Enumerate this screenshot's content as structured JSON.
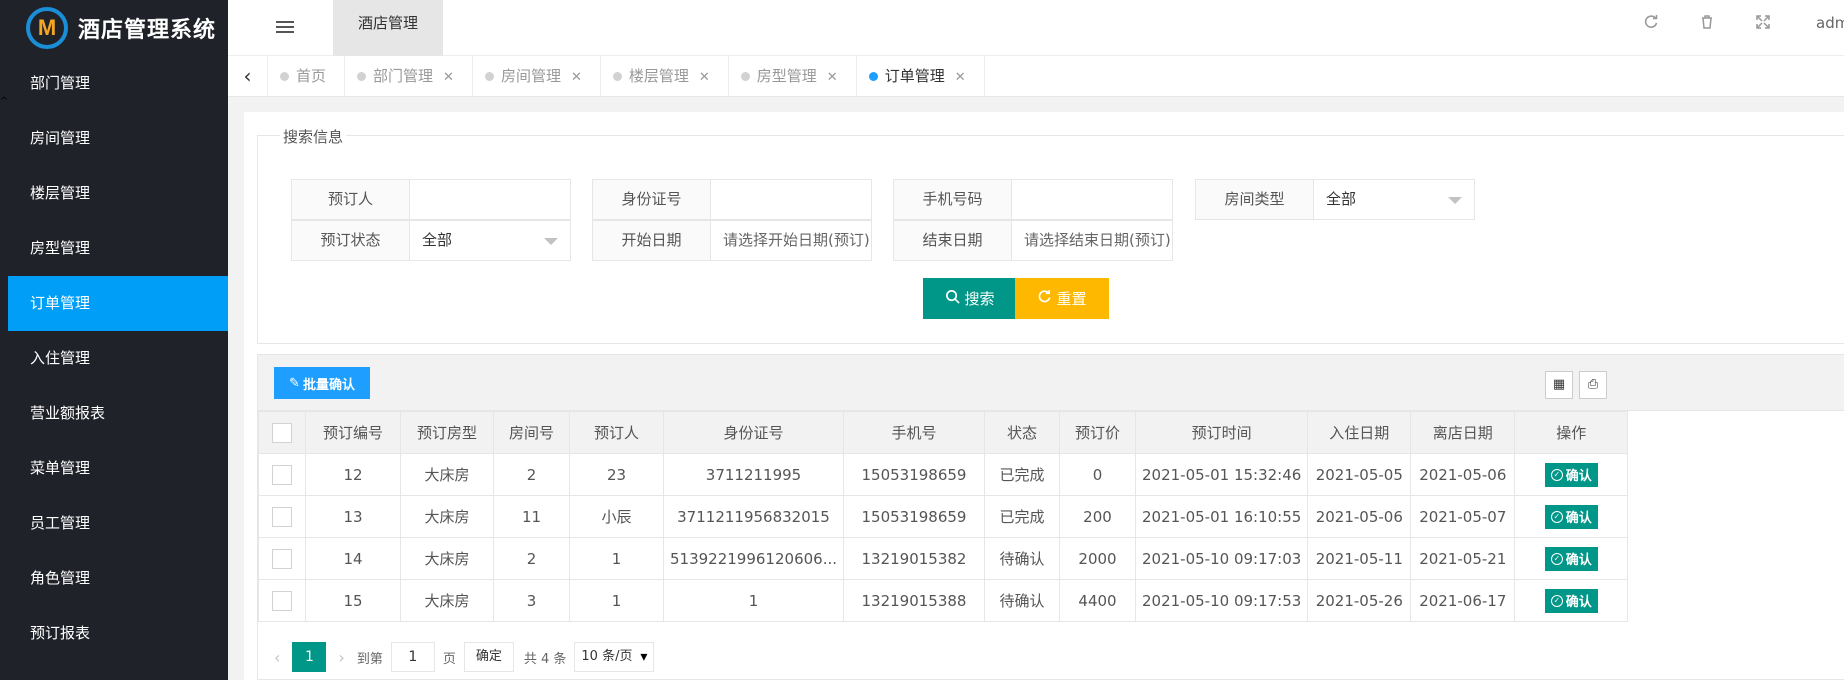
{
  "app": {
    "title": "酒店管理系统",
    "logo_letter": "M"
  },
  "sidebar": {
    "items": [
      {
        "label": "部门管理",
        "active": false
      },
      {
        "label": "房间管理",
        "active": false
      },
      {
        "label": "楼层管理",
        "active": false
      },
      {
        "label": "房型管理",
        "active": false
      },
      {
        "label": "订单管理",
        "active": true
      },
      {
        "label": "入住管理",
        "active": false
      },
      {
        "label": "营业额报表",
        "active": false
      },
      {
        "label": "菜单管理",
        "active": false
      },
      {
        "label": "员工管理",
        "active": false
      },
      {
        "label": "角色管理",
        "active": false
      },
      {
        "label": "预订报表",
        "active": false
      }
    ]
  },
  "header": {
    "tab_label": "酒店管理",
    "user": "adm",
    "icons": [
      "refresh-icon",
      "trash-icon",
      "fullscreen-icon"
    ]
  },
  "tabs": [
    {
      "label": "首页",
      "active": false,
      "closable": false
    },
    {
      "label": "部门管理",
      "active": false,
      "closable": true
    },
    {
      "label": "房间管理",
      "active": false,
      "closable": true
    },
    {
      "label": "楼层管理",
      "active": false,
      "closable": true
    },
    {
      "label": "房型管理",
      "active": false,
      "closable": true
    },
    {
      "label": "订单管理",
      "active": true,
      "closable": true
    }
  ],
  "search": {
    "legend": "搜索信息",
    "fields": {
      "booker": {
        "label": "预订人",
        "value": ""
      },
      "id_card": {
        "label": "身份证号",
        "value": ""
      },
      "phone": {
        "label": "手机号码",
        "value": ""
      },
      "room_type": {
        "label": "房间类型",
        "value": "全部"
      },
      "status": {
        "label": "预订状态",
        "value": "全部"
      },
      "start_date": {
        "label": "开始日期",
        "placeholder": "请选择开始日期(预订)"
      },
      "end_date": {
        "label": "结束日期",
        "placeholder": "请选择结束日期(预订)"
      }
    },
    "search_button": "搜索",
    "reset_button": "重置"
  },
  "table": {
    "batch_button": "批量确认",
    "columns": [
      "预订编号",
      "预订房型",
      "房间号",
      "预订人",
      "身份证号",
      "手机号",
      "状态",
      "预订价",
      "预订时间",
      "入住日期",
      "离店日期",
      "操作"
    ],
    "rows": [
      {
        "id": "12",
        "type": "大床房",
        "room": "2",
        "booker": "23",
        "id_card": "3711211995",
        "phone": "15053198659",
        "status": "已完成",
        "price": "0",
        "time": "2021-05-01 15:32:46",
        "checkin": "2021-05-05",
        "checkout": "2021-05-06",
        "action": "确认"
      },
      {
        "id": "13",
        "type": "大床房",
        "room": "11",
        "booker": "小辰",
        "id_card": "3711211956832015",
        "phone": "15053198659",
        "status": "已完成",
        "price": "200",
        "time": "2021-05-01 16:10:55",
        "checkin": "2021-05-06",
        "checkout": "2021-05-07",
        "action": "确认"
      },
      {
        "id": "14",
        "type": "大床房",
        "room": "2",
        "booker": "1",
        "id_card": "5139221996120606...",
        "phone": "13219015382",
        "status": "待确认",
        "price": "2000",
        "time": "2021-05-10 09:17:03",
        "checkin": "2021-05-11",
        "checkout": "2021-05-21",
        "action": "确认"
      },
      {
        "id": "15",
        "type": "大床房",
        "room": "3",
        "booker": "1",
        "id_card": "1",
        "phone": "13219015388",
        "status": "待确认",
        "price": "4400",
        "time": "2021-05-10 09:17:53",
        "checkin": "2021-05-26",
        "checkout": "2021-06-17",
        "action": "确认"
      }
    ]
  },
  "pager": {
    "current_page": "1",
    "goto_label": "到第",
    "goto_value": "1",
    "page_unit": "页",
    "confirm": "确定",
    "total": "共 4 条",
    "page_size": "10 条/页"
  },
  "colors": {
    "sidebar_bg": "#20222a",
    "active": "#009ef7",
    "teal": "#009688",
    "amber": "#ffb800",
    "blue": "#1e9fff"
  }
}
